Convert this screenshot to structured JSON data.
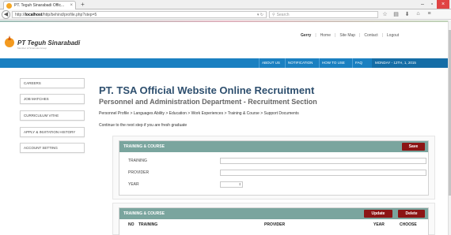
{
  "browser": {
    "tab_title": "PT. Teguh Sinarabadi Offic...",
    "tab_close": "×",
    "new_tab": "+",
    "url_prefix": "http://",
    "url_host": "localhost",
    "url_path": "/http/behind/profile.php?step=5",
    "search_placeholder": "Search",
    "window_min": "–",
    "window_max": "▫",
    "window_close": "×"
  },
  "site": {
    "logo_title": "PT Teguh Sinarabadi",
    "logo_subtitle": "Member of Sinarmas Group",
    "user": "Gerry",
    "top_links": [
      "Home",
      "Site Map",
      "Contact",
      "Logout"
    ],
    "nav": [
      "ABOUT US",
      "NOTIFICATION",
      "HOW TO USE",
      "FAQ"
    ],
    "date": "MONDAY - 12TH, 1, 2015"
  },
  "sidebar": {
    "items": [
      "CAREERS",
      "JOB MATCHES",
      "CURRICULUM VITAE",
      "APPLY & INVITATION HISTORY",
      "ACCOUNT SETTING"
    ]
  },
  "main": {
    "title": "PT. TSA Official Website Online Recruitment",
    "subtitle": "Personnel and Administration Department - Recruitment Section",
    "breadcrumb": "Personnel Profile > Languages Ability > Education > Work Experiences > Training & Course > Support Documents",
    "note": "Continue to the next step if you are fresh graduate"
  },
  "form": {
    "header": "TRAINING & COURSE",
    "save_label": "Save",
    "fields": {
      "training_label": "TRAINING",
      "training_value": "",
      "provider_label": "PROVIDER",
      "provider_value": "",
      "year_label": "YEAR",
      "year_value": ""
    }
  },
  "list": {
    "header": "TRAINING & COURSE",
    "update_label": "Update",
    "delete_label": "Delete",
    "columns": [
      "NO",
      "TRAINING",
      "PROVIDER",
      "YEAR",
      "CHOOSE"
    ]
  },
  "colors": {
    "nav_blue": "#1a80c1",
    "panel_green": "#7aa59e",
    "button_red": "#8c1515",
    "title_blue": "#2e4f6e"
  }
}
